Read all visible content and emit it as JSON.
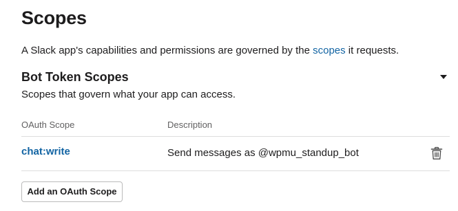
{
  "page": {
    "title": "Scopes",
    "intro_prefix": "A Slack app's capabilities and permissions are governed by the ",
    "intro_link": "scopes",
    "intro_suffix": " it requests."
  },
  "bot_token_scopes": {
    "title": "Bot Token Scopes",
    "description": "Scopes that govern what your app can access.",
    "expanded": true,
    "columns": {
      "scope": "OAuth Scope",
      "description": "Description"
    },
    "rows": [
      {
        "scope": "chat:write",
        "description": "Send messages as @wpmu_standup_bot",
        "action_icon": "trash-icon"
      }
    ],
    "add_button_label": "Add an OAuth Scope"
  },
  "colors": {
    "text": "#1d1c1d",
    "link": "#1264a3",
    "muted": "#616061",
    "divider": "#dddddd"
  }
}
